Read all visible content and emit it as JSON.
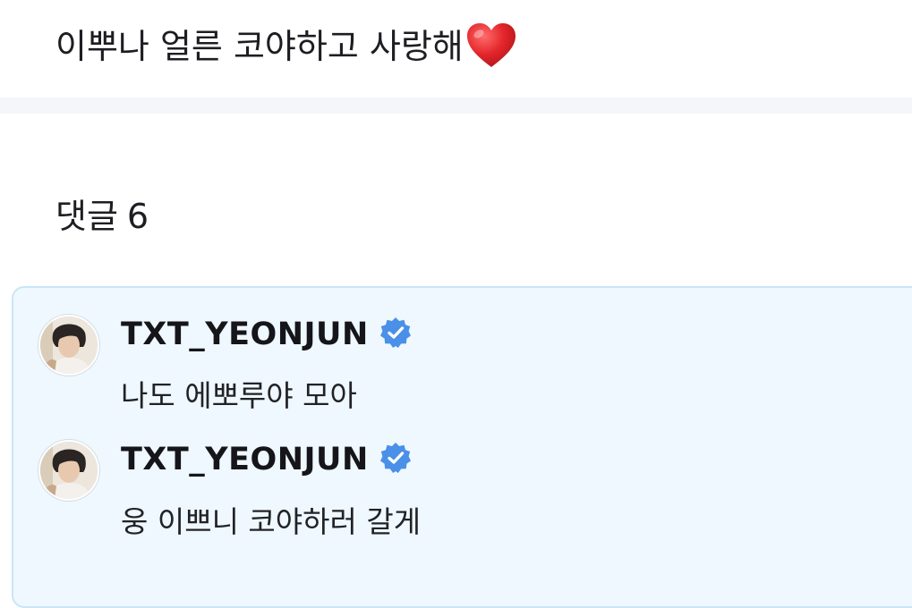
{
  "post": {
    "text": "이뿌나 얼른 코야하고 사랑해",
    "emoji": "heart-emoji"
  },
  "comments_section": {
    "label": "댓글",
    "count": "6"
  },
  "comments": [
    {
      "author": "TXT_YEONJUN",
      "verified": true,
      "text": "나도 에뽀루야 모아"
    },
    {
      "author": "TXT_YEONJUN",
      "verified": true,
      "text": "웅 이쁘니 코야하러 갈게"
    }
  ],
  "colors": {
    "verified_badge": "#4a8fe8",
    "comment_box_bg": "#eef8fe",
    "comment_box_border": "#c9e6f6",
    "heart": "#e0262b"
  }
}
